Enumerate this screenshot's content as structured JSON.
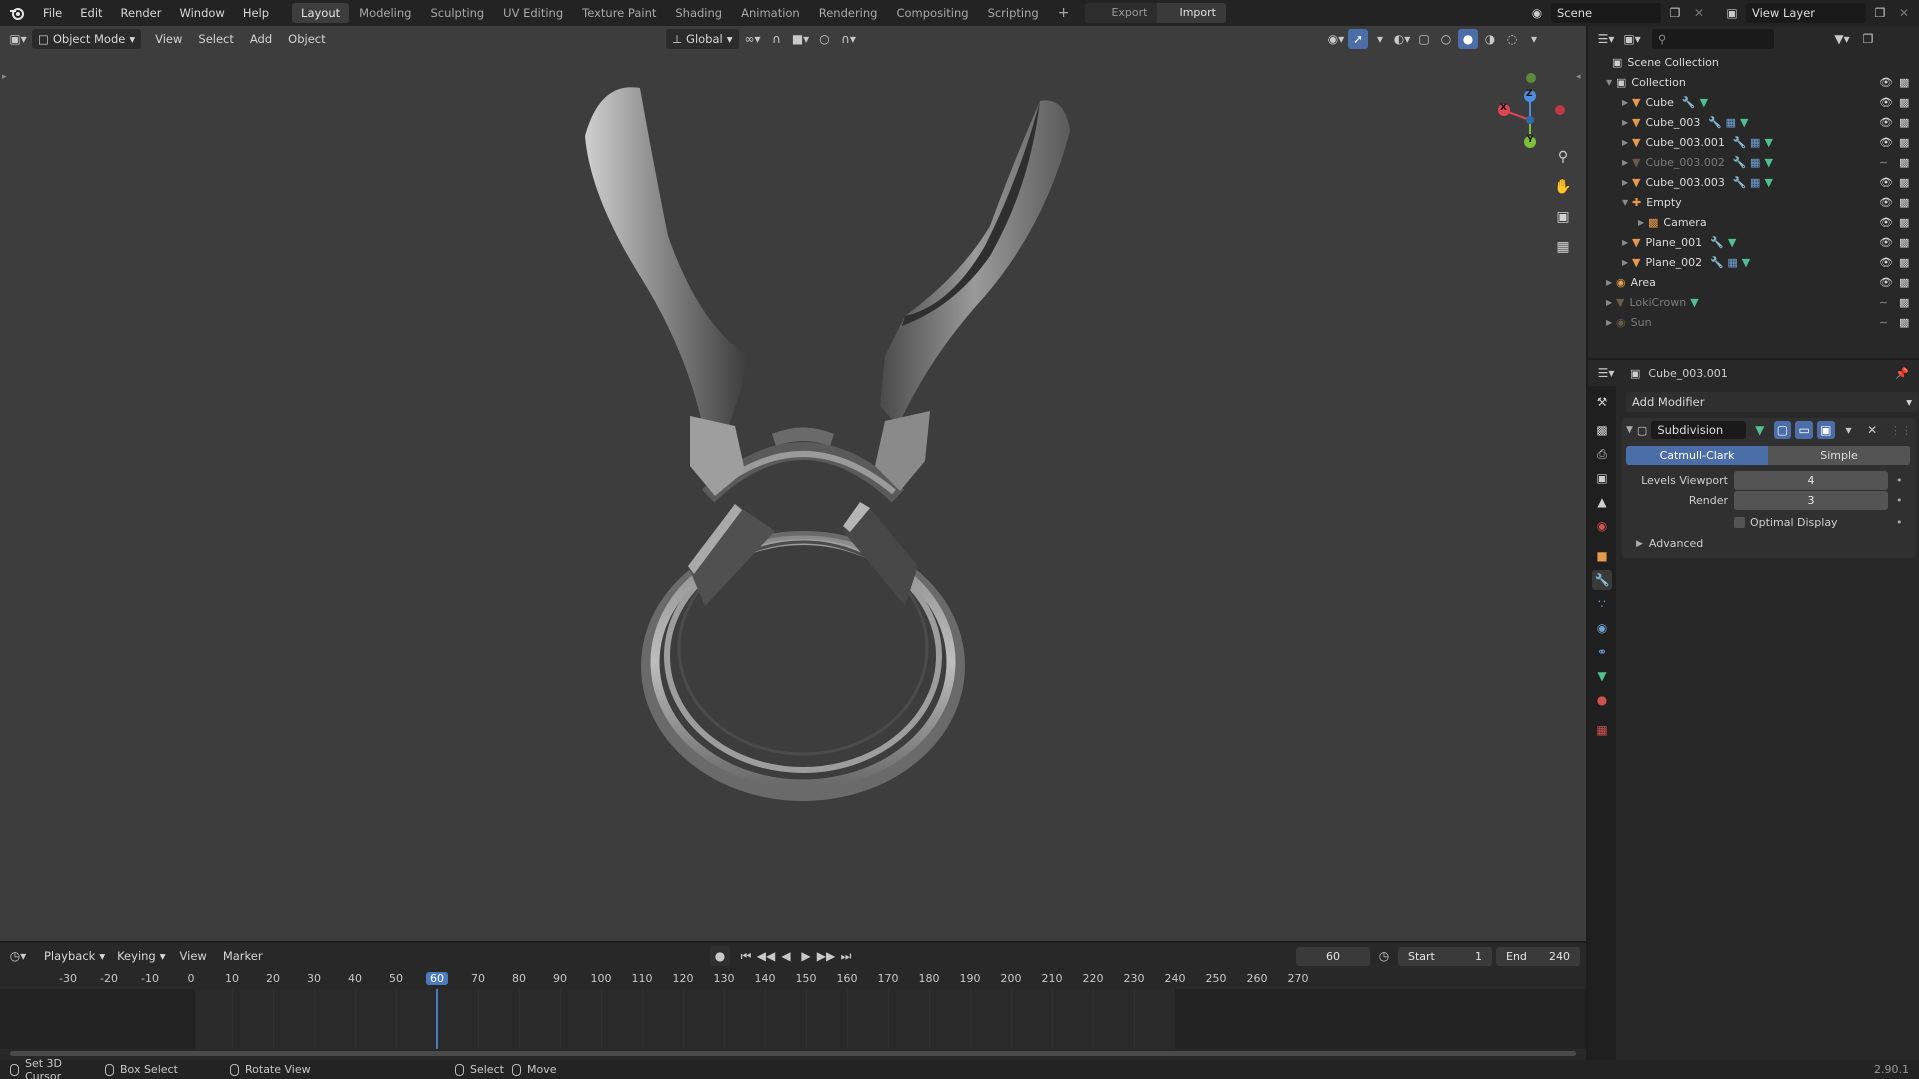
{
  "topbar": {
    "menu": [
      "File",
      "Edit",
      "Render",
      "Window",
      "Help"
    ],
    "workspaces": [
      "Layout",
      "Modeling",
      "Sculpting",
      "UV Editing",
      "Texture Paint",
      "Shading",
      "Animation",
      "Rendering",
      "Compositing",
      "Scripting"
    ],
    "active_workspace": "Layout",
    "add_workspace": "+",
    "export_label": "Export",
    "import_label": "Import",
    "scene_name": "Scene",
    "view_layer": "View Layer"
  },
  "viewport": {
    "mode": "Object Mode",
    "menus": [
      "View",
      "Select",
      "Add",
      "Object"
    ],
    "transform_orientation": "Global",
    "gizmo": {
      "x": "X",
      "y": "Y",
      "z": "Z"
    }
  },
  "outliner": {
    "root": "Scene Collection",
    "items": [
      {
        "name": "Collection",
        "type": "collection",
        "level": 1
      },
      {
        "name": "Cube",
        "type": "mesh",
        "level": 2,
        "mods": 1
      },
      {
        "name": "Cube_003",
        "type": "mesh",
        "level": 2,
        "mods": 2
      },
      {
        "name": "Cube_003.001",
        "type": "mesh",
        "level": 2,
        "mods": 2,
        "selected": true
      },
      {
        "name": "Cube_003.002",
        "type": "mesh",
        "level": 2,
        "mods": 2,
        "hidden": true
      },
      {
        "name": "Cube_003.003",
        "type": "mesh",
        "level": 2,
        "mods": 2
      },
      {
        "name": "Empty",
        "type": "empty",
        "level": 2
      },
      {
        "name": "Camera",
        "type": "camera",
        "level": 3
      },
      {
        "name": "Plane_001",
        "type": "mesh",
        "level": 2,
        "mods": 1
      },
      {
        "name": "Plane_002",
        "type": "mesh",
        "level": 2,
        "mods": 2
      },
      {
        "name": "Area",
        "type": "light",
        "level": 1
      },
      {
        "name": "LokiCrown",
        "type": "mesh",
        "level": 1,
        "hidden": true
      },
      {
        "name": "Sun",
        "type": "light",
        "level": 1,
        "hidden": true
      }
    ]
  },
  "properties": {
    "object_name": "Cube_003.001",
    "add_modifier": "Add Modifier",
    "modifier": {
      "name": "Subdivision",
      "modes": [
        "Catmull-Clark",
        "Simple"
      ],
      "active_mode": "Catmull-Clark",
      "levels_viewport_label": "Levels Viewport",
      "levels_viewport": "4",
      "render_label": "Render",
      "render": "3",
      "optimal_display": "Optimal Display",
      "advanced": "Advanced"
    }
  },
  "timeline": {
    "menus": [
      "Playback",
      "Keying",
      "View",
      "Marker"
    ],
    "current_frame": "60",
    "start_label": "Start",
    "start": "1",
    "end_label": "End",
    "end": "240",
    "ticks": [
      "-30",
      "-20",
      "-10",
      "0",
      "10",
      "20",
      "30",
      "40",
      "50",
      "60",
      "70",
      "80",
      "90",
      "100",
      "110",
      "120",
      "130",
      "140",
      "150",
      "160",
      "170",
      "180",
      "190",
      "200",
      "210",
      "220",
      "230",
      "240",
      "250",
      "260",
      "270"
    ]
  },
  "statusbar": {
    "hints": [
      "Set 3D Cursor",
      "Box Select",
      "Rotate View",
      "Select",
      "Move"
    ],
    "version": "2.90.1"
  },
  "colors": {
    "accent": "#4b6ea8",
    "viewport_bg": "#3d3d3d",
    "playhead": "#4b7bbf",
    "x_axis": "#e04555",
    "y_axis": "#7fbf36",
    "z_axis": "#4a8fe0"
  }
}
